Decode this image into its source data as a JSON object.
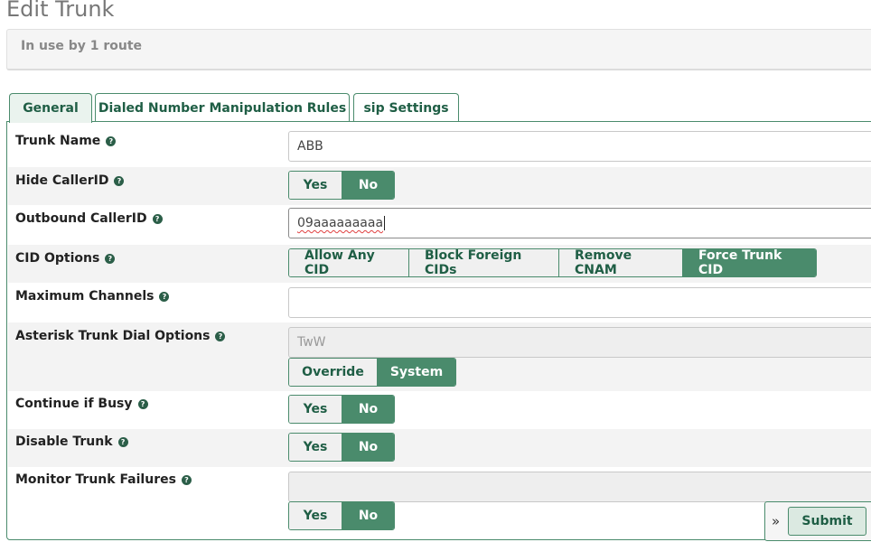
{
  "page": {
    "title": "Edit Trunk",
    "usage": "In use by 1 route"
  },
  "tabs": [
    {
      "label": "General",
      "active": true
    },
    {
      "label": "Dialed Number Manipulation Rules",
      "active": false
    },
    {
      "label": "sip Settings",
      "active": false
    }
  ],
  "help_glyph": "?",
  "form": {
    "trunk_name": {
      "label": "Trunk Name",
      "value": "ABB"
    },
    "hide_callerid": {
      "label": "Hide CallerID",
      "options": [
        "Yes",
        "No"
      ],
      "selected": "No"
    },
    "outbound_callerid": {
      "label": "Outbound CallerID",
      "value": "09aaaaaaaaa"
    },
    "cid_options": {
      "label": "CID Options",
      "options": [
        "Allow Any CID",
        "Block Foreign CIDs",
        "Remove CNAM",
        "Force Trunk CID"
      ],
      "selected": "Force Trunk CID"
    },
    "max_channels": {
      "label": "Maximum Channels",
      "value": ""
    },
    "dial_options": {
      "label": "Asterisk Trunk Dial Options",
      "value": "TwW",
      "options": [
        "Override",
        "System"
      ],
      "selected": "System"
    },
    "continue_if_busy": {
      "label": "Continue if Busy",
      "options": [
        "Yes",
        "No"
      ],
      "selected": "No"
    },
    "disable_trunk": {
      "label": "Disable Trunk",
      "options": [
        "Yes",
        "No"
      ],
      "selected": "No"
    },
    "monitor_failures": {
      "label": "Monitor Trunk Failures",
      "value": "",
      "options": [
        "Yes",
        "No"
      ],
      "selected": "No"
    }
  },
  "actions": {
    "expand_glyph": "»",
    "submit_label": "Submit"
  },
  "colors": {
    "accent": "#4a8b6c",
    "accent_dark": "#1f5e45",
    "row_shade": "#f3f3f3"
  }
}
